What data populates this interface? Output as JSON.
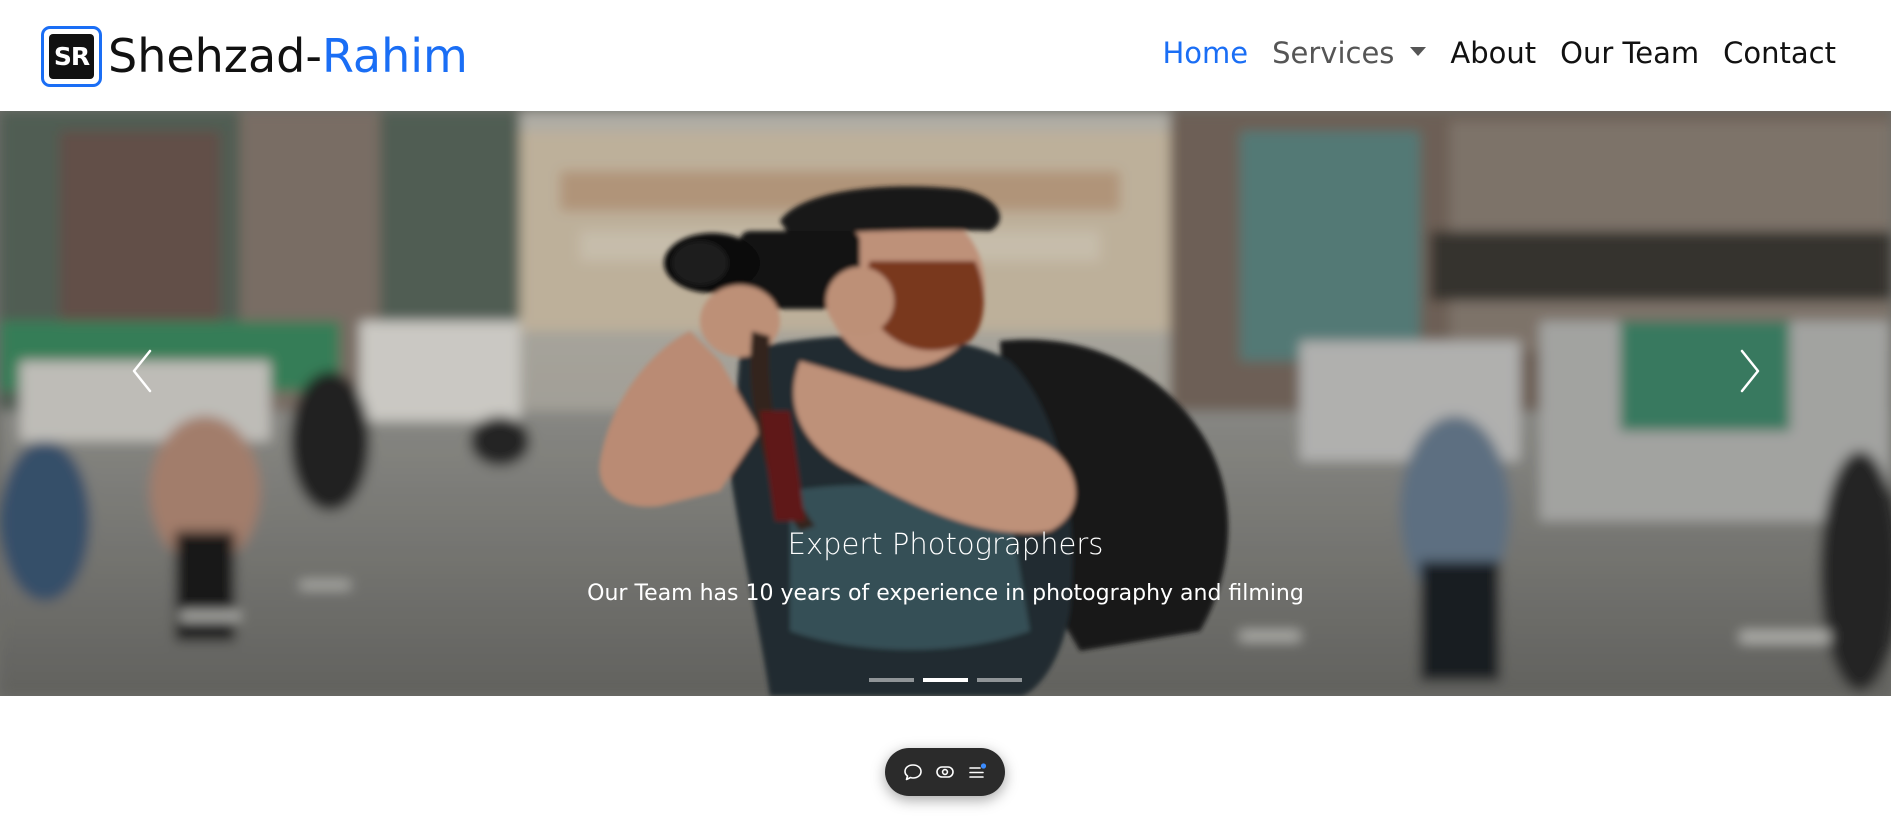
{
  "brand": {
    "logo_text": "SR",
    "name_part1": "Shehzad-",
    "name_part2": "Rahim"
  },
  "nav": {
    "home": "Home",
    "services": "Services",
    "about": "About",
    "our_team": "Our Team",
    "contact": "Contact"
  },
  "carousel": {
    "caption_title": "Expert Photographers",
    "caption_text": "Our Team has 10 years of experience in photography and filming",
    "slide_count": 3,
    "active_slide": 2,
    "prev_icon": "chevron-left-icon",
    "next_icon": "chevron-right-icon"
  },
  "toolbar": {
    "icons": [
      "comment-icon",
      "eye-icon",
      "menu-list-icon"
    ]
  },
  "colors": {
    "accent": "#1a6ef5",
    "text": "#111111",
    "toolbar_bg": "#2b2b2b",
    "notification_dot": "#3b8cff"
  }
}
